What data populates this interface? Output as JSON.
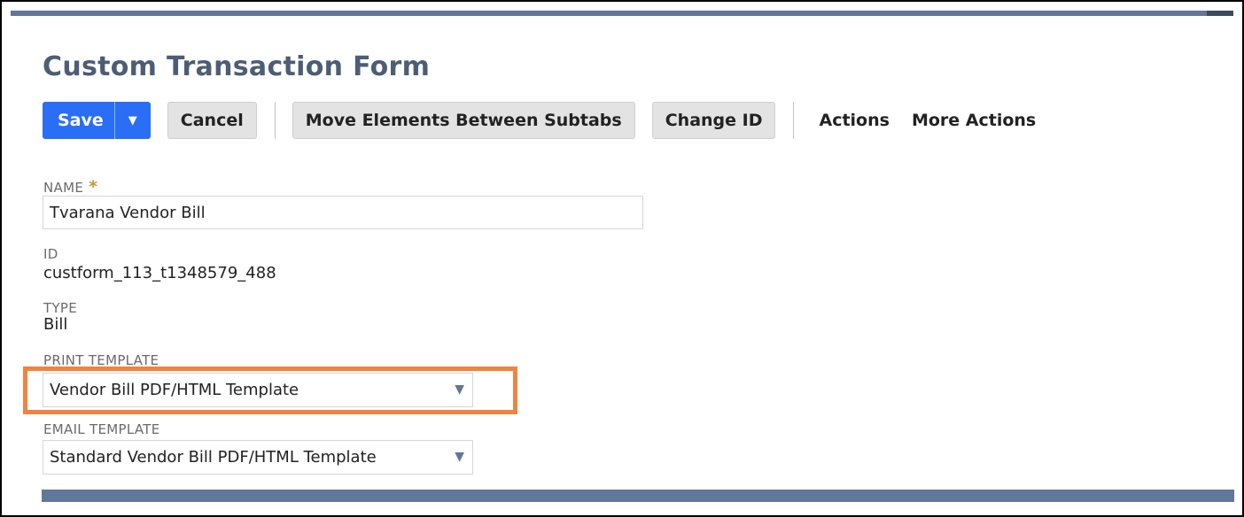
{
  "page": {
    "title": "Custom Transaction Form"
  },
  "toolbar": {
    "save_label": "Save",
    "save_dropdown_icon": "caret-down",
    "cancel_label": "Cancel",
    "move_elements_label": "Move Elements Between Subtabs",
    "change_id_label": "Change ID",
    "actions_label": "Actions",
    "more_actions_label": "More Actions"
  },
  "fields": {
    "name": {
      "label": "NAME",
      "required_marker": "*",
      "value": "Tvarana Vendor Bill"
    },
    "id": {
      "label": "ID",
      "value": "custform_113_t1348579_488"
    },
    "type": {
      "label": "TYPE",
      "value": "Bill"
    },
    "print_template": {
      "label": "PRINT TEMPLATE",
      "value": "Vendor Bill PDF/HTML Template",
      "highlighted": true
    },
    "email_template": {
      "label": "EMAIL TEMPLATE",
      "value": "Standard Vendor Bill PDF/HTML Template"
    }
  },
  "colors": {
    "primary": "#2a6ef5",
    "title": "#4c5d76",
    "bar": "#607799",
    "highlight": "#ef8440",
    "required": "#c99a2e"
  }
}
